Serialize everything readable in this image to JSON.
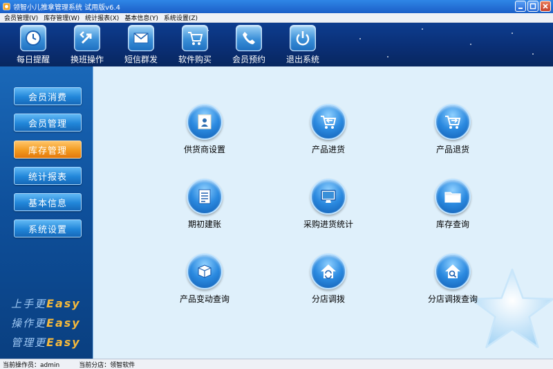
{
  "window": {
    "title": "领智小儿推拿管理系统 试用版v6.4"
  },
  "menu": [
    {
      "label": "会员管理(V)"
    },
    {
      "label": "库存管理(W)"
    },
    {
      "label": "统计报表(X)"
    },
    {
      "label": "基本信息(Y)"
    },
    {
      "label": "系统设置(Z)"
    }
  ],
  "toolbar": [
    {
      "label": "每日提醒",
      "icon": "clock-icon"
    },
    {
      "label": "换班操作",
      "icon": "swap-arrows-icon"
    },
    {
      "label": "短信群发",
      "icon": "envelope-icon"
    },
    {
      "label": "软件购买",
      "icon": "shopping-cart-icon"
    },
    {
      "label": "会员预约",
      "icon": "phone-icon"
    },
    {
      "label": "退出系统",
      "icon": "power-icon"
    }
  ],
  "sidebar": [
    {
      "label": "会员消费",
      "active": false
    },
    {
      "label": "会员管理",
      "active": false
    },
    {
      "label": "库存管理",
      "active": true
    },
    {
      "label": "统计报表",
      "active": false
    },
    {
      "label": "基本信息",
      "active": false
    },
    {
      "label": "系统设置",
      "active": false
    }
  ],
  "slogans": [
    {
      "cn": "上手更",
      "en": "Easy"
    },
    {
      "cn": "操作更",
      "en": "Easy"
    },
    {
      "cn": "管理更",
      "en": "Easy"
    }
  ],
  "functions": [
    {
      "label": "供货商设置",
      "icon": "supplier-card-icon"
    },
    {
      "label": "产品进货",
      "icon": "cart-in-icon"
    },
    {
      "label": "产品退货",
      "icon": "cart-return-icon"
    },
    {
      "label": "期初建账",
      "icon": "ledger-icon"
    },
    {
      "label": "采购进货统计",
      "icon": "monitor-icon"
    },
    {
      "label": "库存查询",
      "icon": "folder-icon"
    },
    {
      "label": "产品变动查询",
      "icon": "product-box-icon"
    },
    {
      "label": "分店调拨",
      "icon": "house-transfer-icon"
    },
    {
      "label": "分店调拨查询",
      "icon": "house-search-icon"
    }
  ],
  "status": {
    "operator": "当前操作员：admin",
    "branch": "当前分店：领智软件"
  },
  "colors": {
    "toolbar_bg": "#0a2e73",
    "sidebar_bg": "#0e4f9a",
    "active_button": "#f29a1f",
    "main_bg": "#dff0fb"
  }
}
